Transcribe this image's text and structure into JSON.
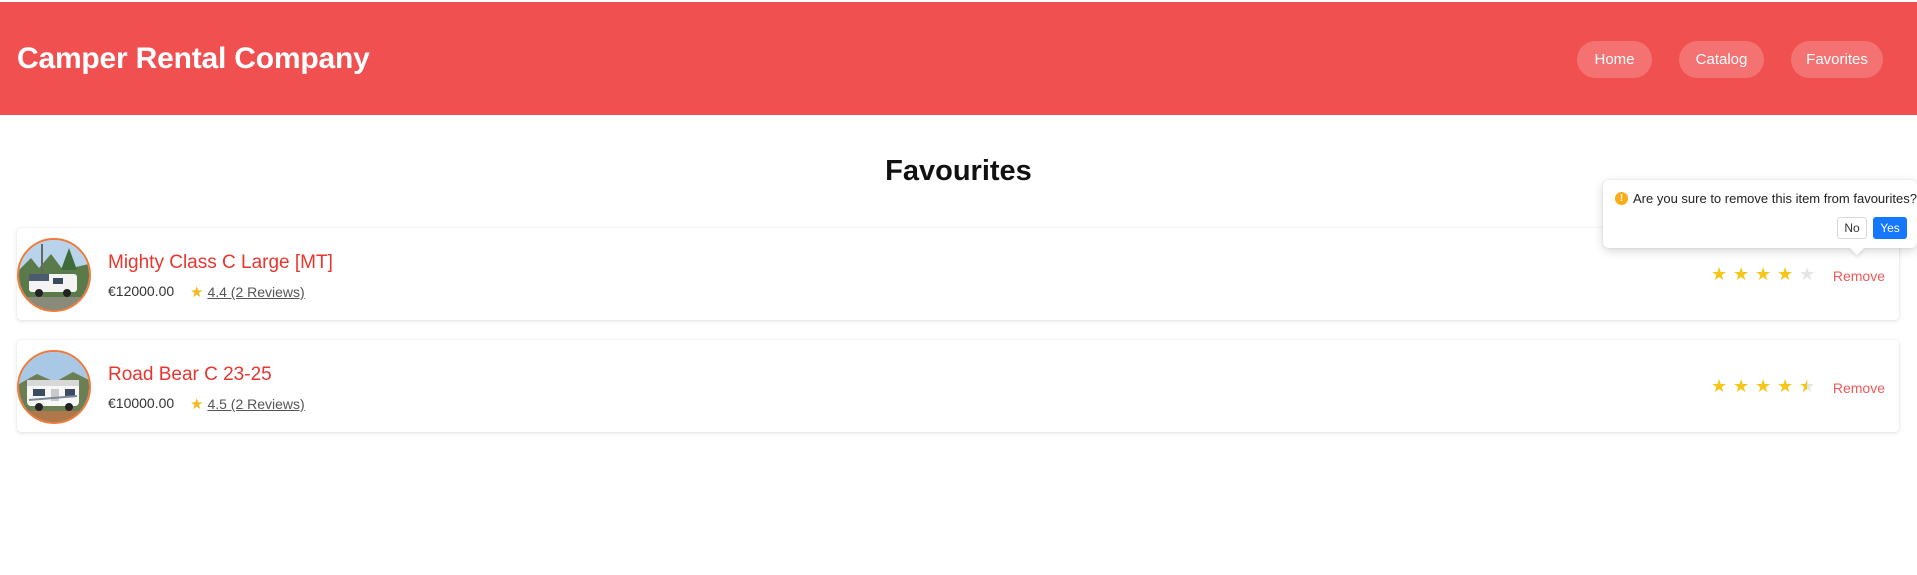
{
  "header": {
    "brand": "Camper Rental Company",
    "nav": [
      {
        "label": "Home"
      },
      {
        "label": "Catalog"
      },
      {
        "label": "Favorites"
      }
    ],
    "color": "#f05050"
  },
  "page": {
    "title": "Favourites"
  },
  "items": [
    {
      "title": "Mighty Class C Large [MT]",
      "price": "€12000.00",
      "rating_text": "4.4 (2 Reviews)",
      "rating": 4.4,
      "remove_label": "Remove"
    },
    {
      "title": "Road Bear C 23-25",
      "price": "€10000.00",
      "rating_text": "4.5 (2 Reviews)",
      "rating": 4.5,
      "remove_label": "Remove"
    }
  ],
  "popconfirm": {
    "message": "Are you sure to remove this item from favourites?",
    "no_label": "No",
    "yes_label": "Yes",
    "icon": "exclamation-circle-icon"
  },
  "colors": {
    "accent": "#f05050",
    "title_red": "#e8362f",
    "star": "#f5c518",
    "primary_button": "#1677ff"
  }
}
